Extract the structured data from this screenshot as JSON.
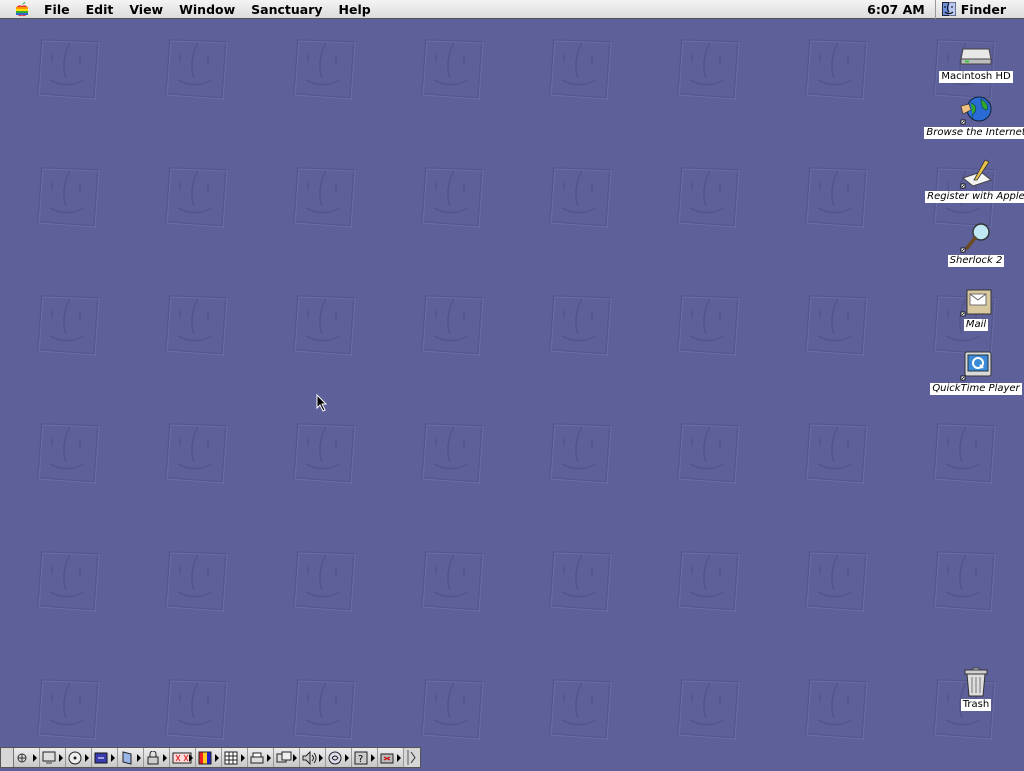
{
  "menubar": {
    "apple_icon": "apple-icon",
    "items": [
      "File",
      "Edit",
      "View",
      "Window",
      "Sanctuary",
      "Help"
    ],
    "clock": "6:07 AM",
    "app_name": "Finder",
    "app_icon": "finder-icon"
  },
  "desktop": {
    "background_color": "#5d6099",
    "wallpaper_motif": "finder-face-icon",
    "icons": [
      {
        "label": "Macintosh HD",
        "icon": "hard-disk-icon",
        "alias": false
      },
      {
        "label": "Browse the Internet",
        "icon": "internet-globe-icon",
        "alias": true
      },
      {
        "label": "Register with Apple",
        "icon": "register-pen-icon",
        "alias": true
      },
      {
        "label": "Sherlock 2",
        "icon": "sherlock-magnifier-icon",
        "alias": true
      },
      {
        "label": "Mail",
        "icon": "mail-icon",
        "alias": true
      },
      {
        "label": "QuickTime Player",
        "icon": "quicktime-icon",
        "alias": true
      },
      {
        "label": "Trash",
        "icon": "trash-icon",
        "alias": false
      }
    ]
  },
  "control_strip": {
    "modules": [
      "appletalk-icon",
      "monitor-bit-depth-icon",
      "cd-player-icon",
      "file-sharing-icon",
      "remote-access-icon",
      "keychain-lock-icon",
      "extensions-manager-icon",
      "color-depth-icon",
      "resolution-icon",
      "printer-icon",
      "location-manager-icon",
      "sound-volume-icon",
      "speech-icon",
      "web-sharing-icon",
      "energy-saver-icon"
    ]
  }
}
